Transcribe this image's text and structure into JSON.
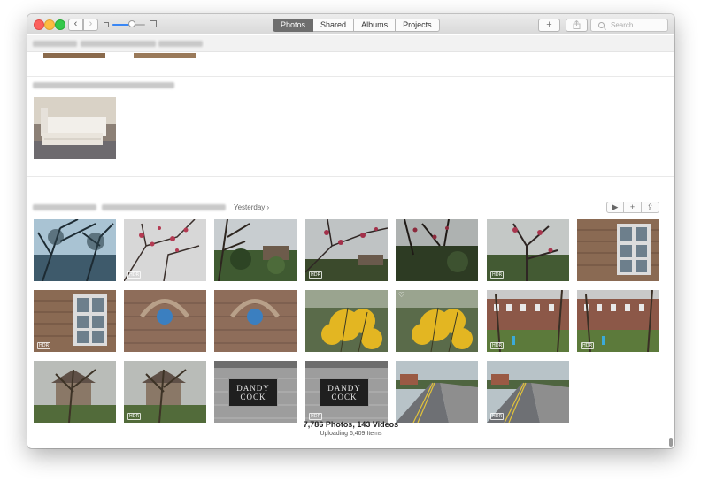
{
  "toolbar": {
    "back_glyph": "‹",
    "forward_glyph": "›",
    "tabs": [
      "Photos",
      "Shared",
      "Albums",
      "Projects"
    ],
    "active_tab": "Photos",
    "add_glyph": "+",
    "share_icon": "share-icon",
    "search_placeholder": "Search",
    "zoom_level": 0.6
  },
  "groups": {
    "yesterday_label": "Yesterday ›",
    "actions": [
      "▶",
      "+",
      "⇪"
    ]
  },
  "photos": [
    {
      "scene": "tree-sky",
      "hdr": false
    },
    {
      "scene": "blossom",
      "hdr": true
    },
    {
      "scene": "garden",
      "hdr": false
    },
    {
      "scene": "blossom-dark",
      "hdr": true
    },
    {
      "scene": "garden-dark",
      "hdr": false
    },
    {
      "scene": "blossom-garden",
      "hdr": true
    },
    {
      "scene": "stone-window",
      "hdr": false
    },
    {
      "scene": "stone-window",
      "hdr": true
    },
    {
      "scene": "plaque",
      "hdr": false
    },
    {
      "scene": "plaque",
      "hdr": false
    },
    {
      "scene": "forsythia",
      "hdr": false
    },
    {
      "scene": "forsythia",
      "hdr": false,
      "favorite": true
    },
    {
      "scene": "terrace",
      "hdr": true
    },
    {
      "scene": "terrace",
      "hdr": true
    },
    {
      "scene": "tree-house",
      "hdr": false
    },
    {
      "scene": "tree-house",
      "hdr": true
    },
    {
      "scene": "dandy-sign",
      "hdr": false
    },
    {
      "scene": "dandy-sign",
      "hdr": true
    },
    {
      "scene": "road",
      "hdr": false
    },
    {
      "scene": "road",
      "hdr": true
    }
  ],
  "hdr_label": "HDR",
  "favorite_glyph": "♡",
  "sign_text": "DANDY COCK",
  "footer": {
    "counts": "7,786 Photos, 143 Videos",
    "status": "Uploading 6,409 Items"
  }
}
